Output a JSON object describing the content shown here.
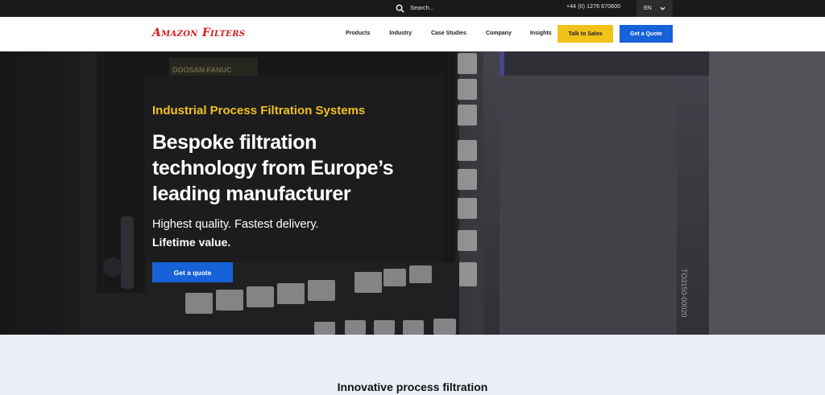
{
  "topbar": {
    "search_label": "Search...",
    "phone": "+44 (0) 1276 670600",
    "language": "EN"
  },
  "header": {
    "logo_text": "Amazon Filters",
    "nav": [
      "Products",
      "Industry",
      "Case Studies",
      "Company",
      "Insights"
    ],
    "talk_to_sales": "Talk to Sales",
    "get_a_quote": "Get a Quote"
  },
  "hero": {
    "kicker": "Industrial Process Filtration Systems",
    "headline": "Bespoke filtration technology from Europe’s leading manufacturer",
    "subline_1": "Highest quality. Fastest delivery.",
    "subline_2": "Lifetime value.",
    "cta": "Get a quote",
    "image_texts": [
      "DOOSAN-FANUC",
      "TO3150-00020"
    ]
  },
  "section": {
    "title": "Innovative process filtration"
  },
  "colors": {
    "brand_red": "#d11f1f",
    "accent_yellow": "#f2c21b",
    "primary_blue": "#1761d9",
    "topbar_bg": "#1a1a1a",
    "lower_bg": "#e9eef8"
  }
}
